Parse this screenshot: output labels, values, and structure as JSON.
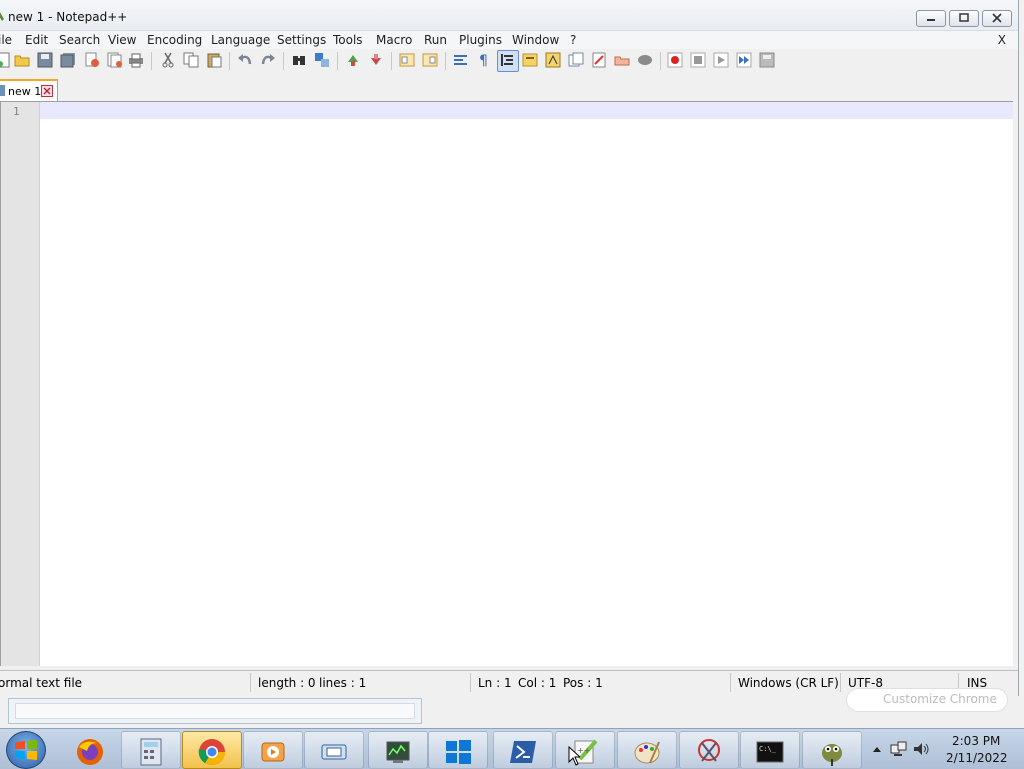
{
  "window": {
    "title": "new 1 - Notepad++",
    "close_x": "X"
  },
  "menu": {
    "items": [
      "ile",
      "Edit",
      "Search",
      "View",
      "Encoding",
      "Language",
      "Settings",
      "Tools",
      "Macro",
      "Run",
      "Plugins",
      "Window",
      "?"
    ]
  },
  "toolbar": {
    "icons": [
      "new-file",
      "open-file",
      "save",
      "save-all",
      "close",
      "close-all",
      "print",
      "cut",
      "copy",
      "paste",
      "undo",
      "redo",
      "find",
      "replace",
      "zoom-in",
      "zoom-out",
      "sync-vertical",
      "sync-horizontal",
      "word-wrap",
      "show-all-chars",
      "indent-guide",
      "doc-map",
      "function-list",
      "folder-workspace",
      "monitoring",
      "record-macro",
      "stop-recording",
      "play-macro",
      "run-macro-multiple",
      "save-macro"
    ],
    "active_icon": "indent-guide"
  },
  "tabs": [
    {
      "label": "new 1",
      "active": true
    }
  ],
  "editor": {
    "line_numbers": [
      "1"
    ],
    "content": ""
  },
  "status": {
    "file_type": "ormal text file",
    "length": "length : 0",
    "lines": "lines : 1",
    "ln": "Ln : 1",
    "col": "Col : 1",
    "pos": "Pos : 1",
    "eol": "Windows (CR LF)",
    "encoding": "UTF-8",
    "mode": "INS"
  },
  "background": {
    "chrome_button": "Customize Chrome"
  },
  "taskbar": {
    "apps": [
      "calculator",
      "chrome",
      "media-player",
      "display",
      "task-manager",
      "windows-store",
      "powershell",
      "notepad-plus-plus",
      "paint",
      "snipping-tool",
      "command-prompt",
      "gimp"
    ],
    "active_app": "chrome"
  },
  "clock": {
    "time": "2:03 PM",
    "date": "2/11/2022"
  },
  "colors": {
    "tab_accent": "#f5a623",
    "current_line": "#e8e8ff",
    "taskbar": "#b9c9de"
  }
}
